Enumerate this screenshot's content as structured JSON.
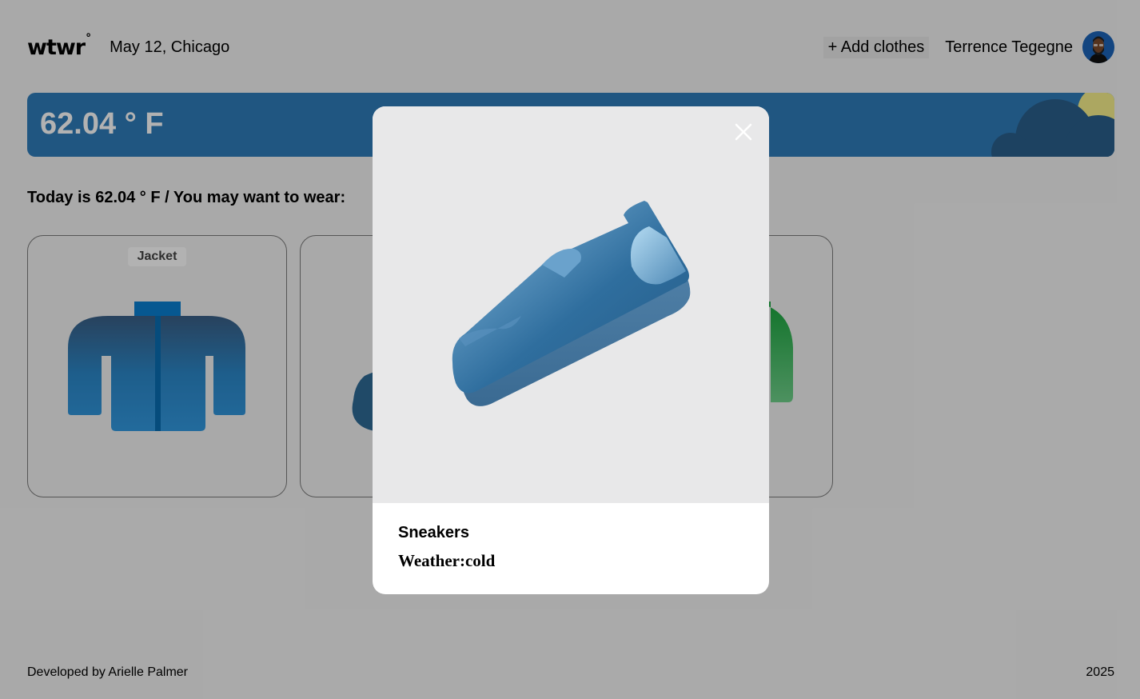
{
  "header": {
    "logo_text": "wtwr",
    "logo_degree": "°",
    "date_location": "May 12, Chicago",
    "add_clothes_label": "+ Add clothes",
    "user_name": "Terrence Tegegne"
  },
  "weather": {
    "temperature": "62.04 ° F",
    "condition_icon": "cloud-sun-icon"
  },
  "main": {
    "today_text": "Today is 62.04 ° F / You may want to wear:",
    "items": [
      {
        "label": "Jacket",
        "icon": "jacket-icon"
      },
      {
        "label": "",
        "icon": "sneaker-icon"
      },
      {
        "label": "",
        "icon": "shirt-icon"
      }
    ]
  },
  "modal": {
    "item_name": "Sneakers",
    "weather_label": "Weather:cold",
    "image_icon": "sneaker-icon"
  },
  "footer": {
    "developer": "Developed by Arielle Palmer",
    "year": "2025"
  },
  "colors": {
    "weather_bg": "#2f7bb9",
    "page_bg": "#f3f3f3",
    "modal_image_bg": "#e8e8e9",
    "overlay": "rgba(0,0,0,0.3)"
  }
}
